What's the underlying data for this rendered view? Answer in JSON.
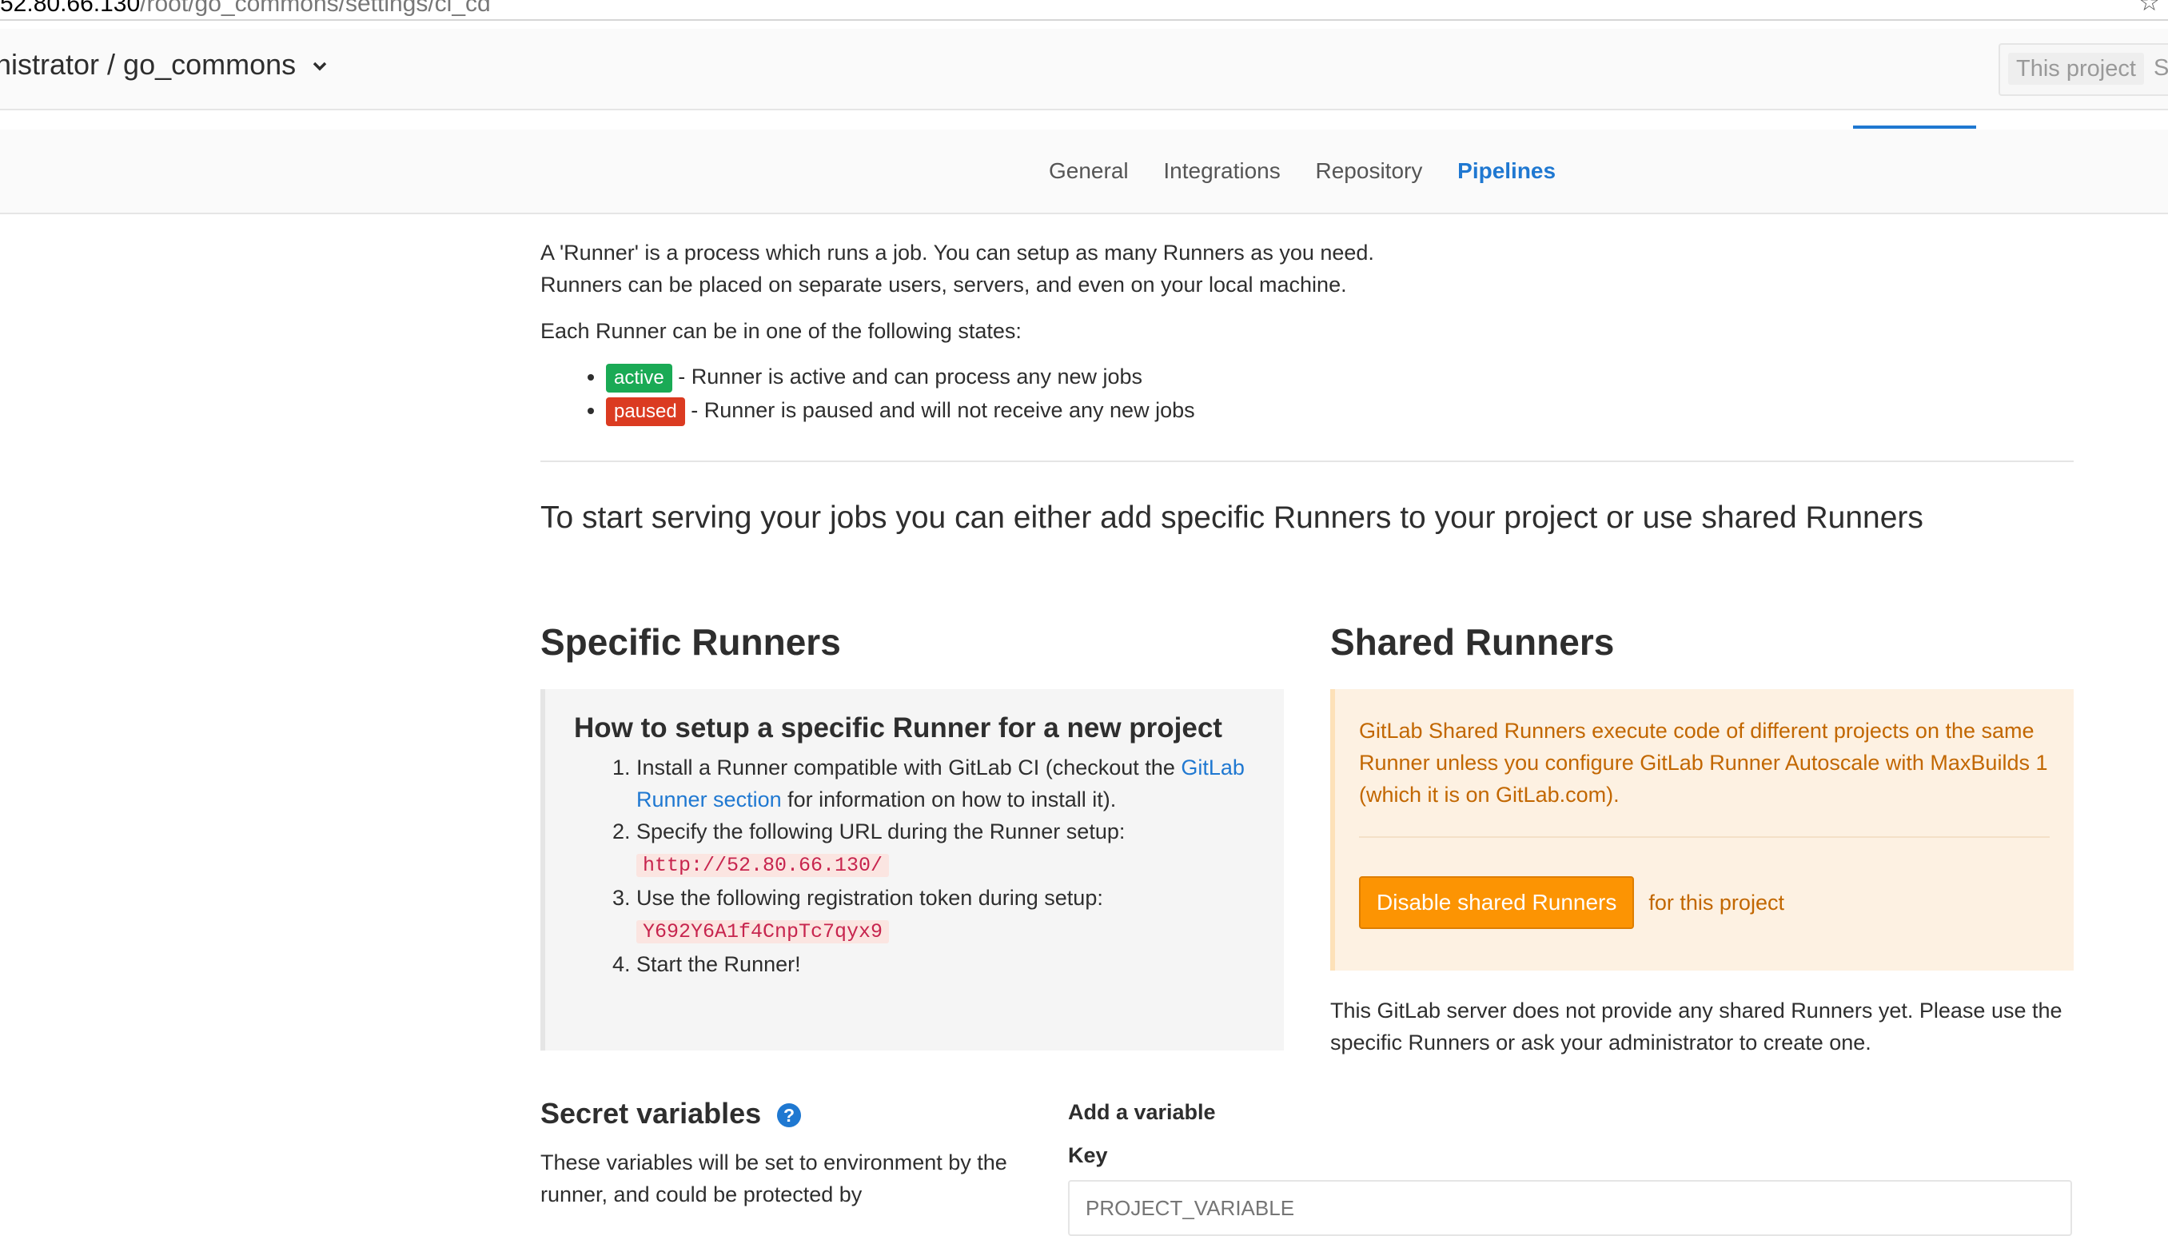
{
  "browser": {
    "url_host": "52.80.66.130",
    "url_path": "/root/go_commons/settings/ci_cd"
  },
  "header": {
    "breadcrumb": "nistrator / go_commons",
    "search_scope": "This project",
    "search_trail": "S"
  },
  "nav": {
    "tabs": [
      {
        "label": "General"
      },
      {
        "label": "Integrations"
      },
      {
        "label": "Repository"
      },
      {
        "label": "Pipelines"
      }
    ]
  },
  "intro": {
    "line1": "A 'Runner' is a process which runs a job. You can setup as many Runners as you need.",
    "line2": "Runners can be placed on separate users, servers, and even on your local machine.",
    "states_intro": "Each Runner can be in one of the following states:",
    "states": [
      {
        "badge": "active",
        "text": " - Runner is active and can process any new jobs"
      },
      {
        "badge": "paused",
        "text": " - Runner is paused and will not receive any new jobs"
      }
    ]
  },
  "lead": "To start serving your jobs you can either add specific Runners to your project or use shared Runners",
  "specific": {
    "title": "Specific Runners",
    "heading": "How to setup a specific Runner for a new project",
    "step1_a": "Install a Runner compatible with GitLab CI (checkout the ",
    "step1_link": "GitLab Runner section",
    "step1_b": " for information on how to install it).",
    "step2": "Specify the following URL during the Runner setup:",
    "url": "http://52.80.66.130/",
    "step3": "Use the following registration token during setup:",
    "token": "Y692Y6A1f4CnpTc7qyx9",
    "step4": "Start the Runner!"
  },
  "shared": {
    "title": "Shared Runners",
    "warning": "GitLab Shared Runners execute code of different projects on the same Runner unless you configure GitLab Runner Autoscale with MaxBuilds 1 (which it is on GitLab.com).",
    "button": "Disable shared Runners",
    "button_suffix": "for this project",
    "note": "This GitLab server does not provide any shared Runners yet. Please use the specific Runners or ask your administrator to create one."
  },
  "secret": {
    "title": "Secret variables",
    "description": "These variables will be set to environment by the runner, and could be protected by",
    "add_variable": "Add a variable",
    "key_label": "Key",
    "key_placeholder": "PROJECT_VARIABLE"
  },
  "colors": {
    "link": "#1f78d1",
    "active_badge": "#1aaa55",
    "paused_badge": "#db3b21",
    "warning_button": "#fc9403",
    "warning_text": "#c26700"
  }
}
